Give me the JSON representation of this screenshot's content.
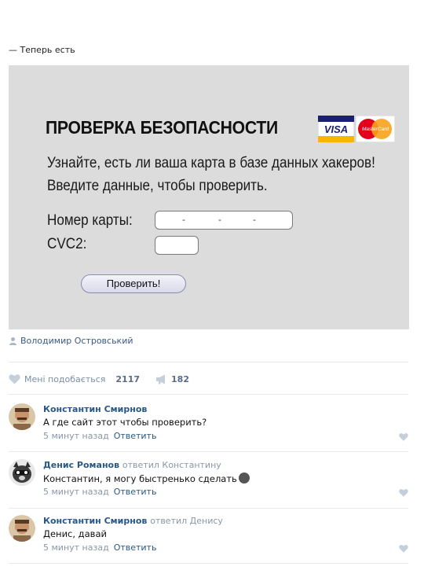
{
  "post": {
    "text": "— Теперь есть",
    "author": "Володимир Островський"
  },
  "image": {
    "title": "ПРОВЕРКА БЕЗОПАСНОСТИ",
    "logo_visa": "VISA",
    "logo_mastercard": "MasterCard",
    "line1": "Узнайте, есть ли ваша карта в базе данных хакеров!",
    "line2": "Введите данные, чтобы проверить.",
    "card_label": "Номер карты:",
    "card_field_separators": [
      "-",
      "-",
      "-"
    ],
    "cvc_label": "CVC2:",
    "check_button": "Проверить!"
  },
  "stats": {
    "likes_label": "Мені подобається",
    "likes_count": "2117",
    "shares_count": "182"
  },
  "comments": [
    {
      "name": "Константин Смирнов",
      "reply_to": "",
      "text": "А где сайт этот чтобы проверить?",
      "time": "5 минут назад",
      "answer": "Ответить"
    },
    {
      "name": "Денис Романов",
      "reply_to": "ответил Константину",
      "text": "Константин, я могу быстренько сделать",
      "time": "5 минут назад",
      "answer": "Ответить"
    },
    {
      "name": "Константин Смирнов",
      "reply_to": "ответил Денису",
      "text": "Денис, давай",
      "time": "5 минут назад",
      "answer": "Ответить"
    }
  ],
  "colors": {
    "link": "#2a5885",
    "muted": "#8a97a7",
    "card_bg": "#dcdcdc"
  }
}
